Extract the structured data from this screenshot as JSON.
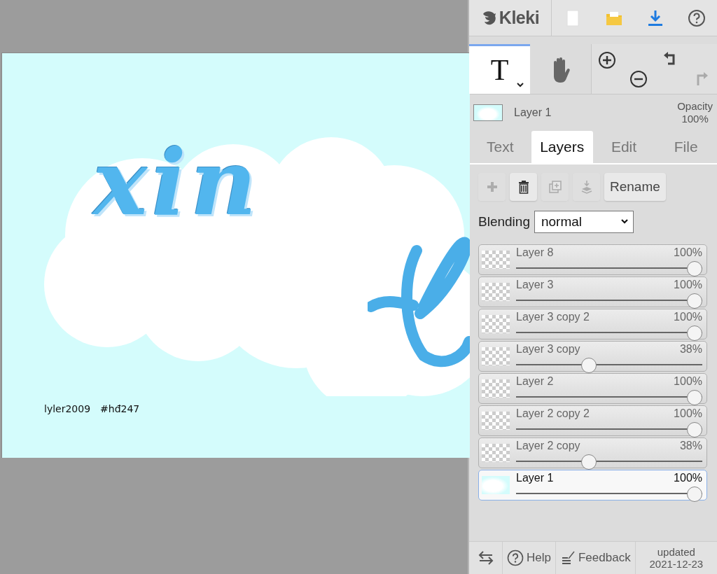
{
  "canvas": {
    "lettering": [
      "xin"
    ],
    "signature": [
      "lyler2009",
      "#hđ247"
    ]
  },
  "top_bar": {
    "logo": "Kleki",
    "buttons": [
      {
        "kind": "new"
      },
      {
        "kind": "open"
      },
      {
        "kind": "download"
      },
      {
        "kind": "help"
      }
    ]
  },
  "tools": [
    {
      "kind": "text",
      "glyph": "T",
      "selected": true
    },
    {
      "kind": "hand",
      "selected": false
    }
  ],
  "layer_info": {
    "name": "Layer 1",
    "opacity_label": "Opacity",
    "opacity_value": "100%"
  },
  "tabs": [
    {
      "label": "Text",
      "selected": false
    },
    {
      "label": "Layers",
      "selected": true
    },
    {
      "label": "Edit",
      "selected": false
    },
    {
      "label": "File",
      "selected": false
    }
  ],
  "layer_actions": [
    {
      "kind": "add",
      "disabled": true
    },
    {
      "kind": "delete",
      "disabled": false
    },
    {
      "kind": "duplicate",
      "disabled": true
    },
    {
      "kind": "merge",
      "disabled": true
    },
    {
      "kind": "rename",
      "label": "Rename",
      "disabled": false
    }
  ],
  "blending": {
    "label": "Blending",
    "value": "normal"
  },
  "layers": [
    {
      "name": "Layer 8",
      "opacity": "100%",
      "level": 1,
      "kind": "transparent",
      "selected": false
    },
    {
      "name": "Layer 3",
      "opacity": "100%",
      "level": 1,
      "kind": "transparent",
      "selected": false
    },
    {
      "name": "Layer 3 copy 2",
      "opacity": "100%",
      "level": 1,
      "kind": "transparent",
      "selected": false
    },
    {
      "name": "Layer 3 copy",
      "opacity": "38%",
      "level": 0.38,
      "kind": "transparent",
      "selected": false
    },
    {
      "name": "Layer 2",
      "opacity": "100%",
      "level": 1,
      "kind": "transparent",
      "selected": false
    },
    {
      "name": "Layer 2 copy 2",
      "opacity": "100%",
      "level": 1,
      "kind": "transparent",
      "selected": false
    },
    {
      "name": "Layer 2 copy",
      "opacity": "38%",
      "level": 0.38,
      "kind": "transparent",
      "selected": false
    },
    {
      "name": "Layer 1",
      "opacity": "100%",
      "level": 1,
      "kind": "background",
      "selected": true
    }
  ],
  "footer": {
    "help": "Help",
    "feedback": "Feedback",
    "updated": [
      "updated",
      "2021-12-23"
    ]
  }
}
